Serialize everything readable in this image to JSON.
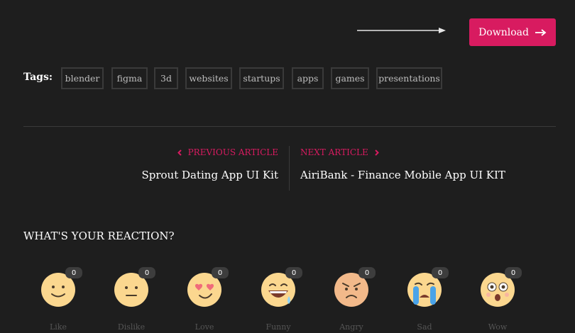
{
  "download": {
    "label": "Download"
  },
  "tags": {
    "label": "Tags:",
    "items": [
      "blender",
      "figma",
      "3d",
      "websites",
      "startups",
      "apps",
      "games",
      "presentations"
    ]
  },
  "nav": {
    "previous": {
      "label": "PREVIOUS ARTICLE",
      "title": "Sprout Dating App UI Kit"
    },
    "next": {
      "label": "NEXT ARTICLE",
      "title": "AiriBank - Finance Mobile App UI KIT"
    }
  },
  "reactions": {
    "heading": "WHAT'S YOUR REACTION?",
    "items": [
      {
        "icon": "smile-emoji-icon",
        "count": "0",
        "label": "Like"
      },
      {
        "icon": "neutral-emoji-icon",
        "count": "0",
        "label": "Dislike"
      },
      {
        "icon": "heart-eyes-emoji-icon",
        "count": "0",
        "label": "Love"
      },
      {
        "icon": "laughing-emoji-icon",
        "count": "0",
        "label": "Funny"
      },
      {
        "icon": "angry-emoji-icon",
        "count": "0",
        "label": "Angry"
      },
      {
        "icon": "crying-emoji-icon",
        "count": "0",
        "label": "Sad"
      },
      {
        "icon": "wow-emoji-icon",
        "count": "0",
        "label": "Wow"
      }
    ]
  },
  "colors": {
    "accent": "#d81b60",
    "background": "#1e1e1e",
    "border": "#3a3a3a"
  }
}
